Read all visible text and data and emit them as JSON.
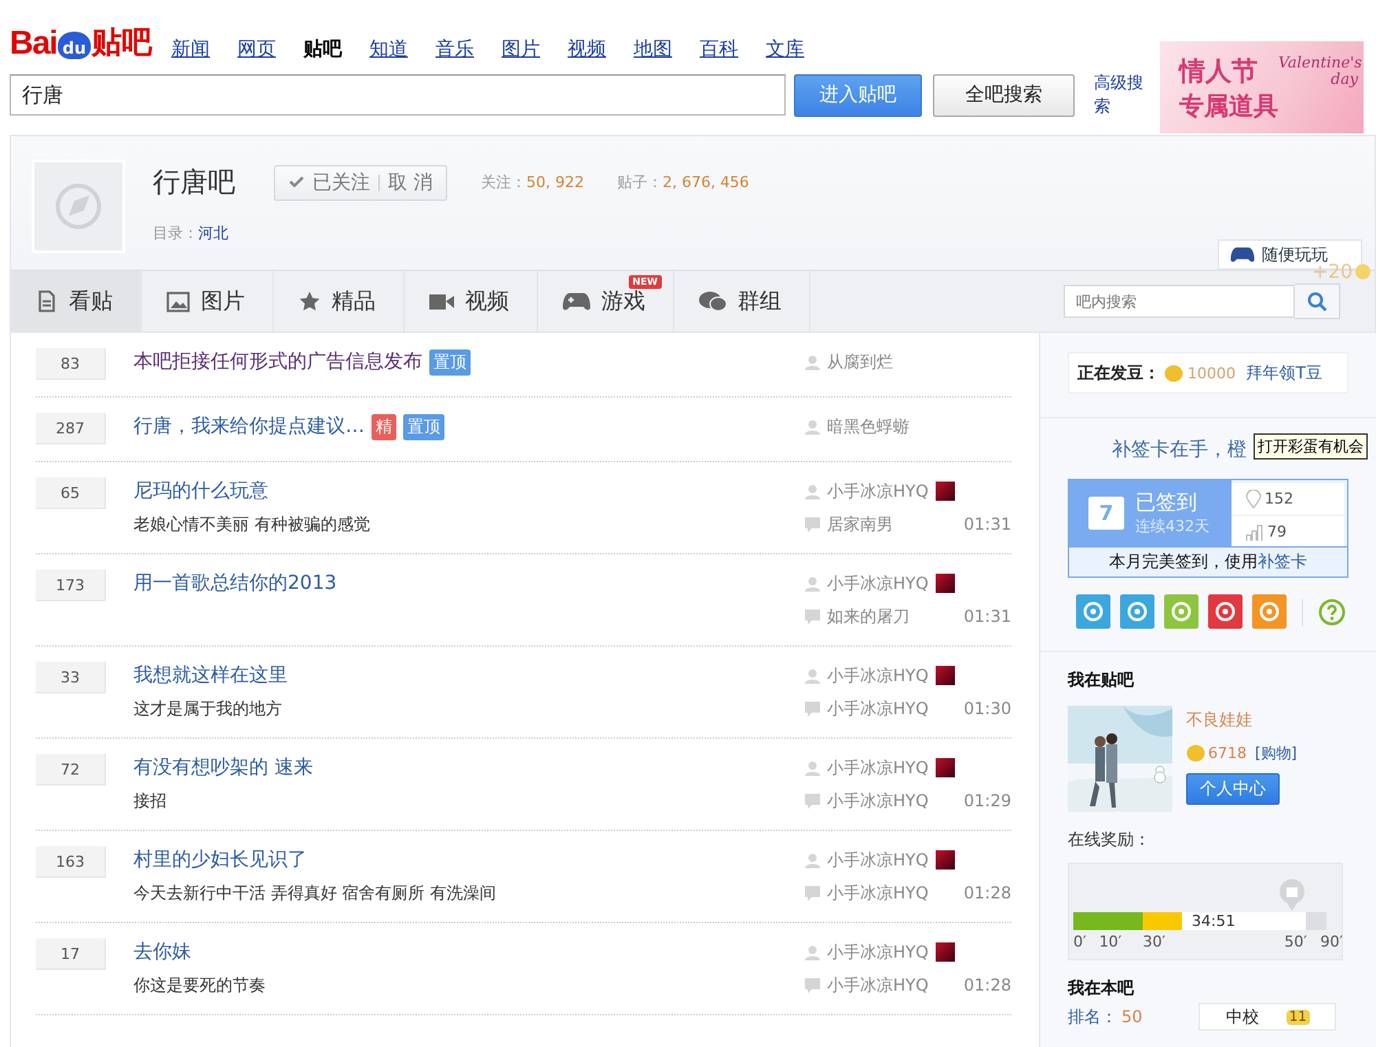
{
  "header": {
    "logo": {
      "brand": "Bai",
      "paw": "du",
      "name": "贴吧"
    },
    "nav": [
      {
        "label": "新闻",
        "selected": false
      },
      {
        "label": "网页",
        "selected": false
      },
      {
        "label": "贴吧",
        "selected": true
      },
      {
        "label": "知道",
        "selected": false
      },
      {
        "label": "音乐",
        "selected": false
      },
      {
        "label": "图片",
        "selected": false
      },
      {
        "label": "视频",
        "selected": false
      },
      {
        "label": "地图",
        "selected": false
      },
      {
        "label": "百科",
        "selected": false
      },
      {
        "label": "文库",
        "selected": false
      }
    ],
    "search": {
      "value": "行唐"
    },
    "buttons": [
      {
        "label": "进入贴吧",
        "kind": "primary"
      },
      {
        "label": "全吧搜索",
        "kind": "secondary"
      }
    ],
    "advanced_link": "高级搜索",
    "banner": {
      "title": "情人节",
      "subtitle": "Valentine's day",
      "tagline": "专属道具"
    }
  },
  "forum": {
    "name": "行唐吧",
    "follow": {
      "label": "已关注",
      "action": "取 消",
      "followed": true
    },
    "stats": [
      {
        "label": "关注：",
        "value": "50, 922"
      },
      {
        "label": "贴子：",
        "value": "2, 676, 456"
      }
    ],
    "directory": {
      "label": "目录：",
      "value": "河北"
    },
    "play_button": "随便玩玩",
    "bonus": "+20"
  },
  "tabs": [
    {
      "label": "看贴",
      "selected": true
    },
    {
      "label": "图片",
      "selected": false
    },
    {
      "label": "精品",
      "selected": false
    },
    {
      "label": "视频",
      "selected": false
    },
    {
      "label": "游戏",
      "selected": false,
      "badge": "NEW"
    },
    {
      "label": "群组",
      "selected": false
    }
  ],
  "tab_search": {
    "placeholder": "吧内搜索"
  },
  "threads": [
    {
      "replies": "83",
      "title": "本吧拒接任何形式的广告信息发布",
      "visited": true,
      "tags": [
        {
          "label": "置顶",
          "color": "#5a9ae6"
        }
      ],
      "author": "从腐到烂",
      "author_badge": false
    },
    {
      "replies": "287",
      "title": "行唐，我来给你提点建议…",
      "visited": false,
      "tags": [
        {
          "label": "精",
          "color": "#e8605a"
        },
        {
          "label": "置顶",
          "color": "#5a9ae6"
        }
      ],
      "author": "暗黑色蜉蝣",
      "author_badge": false
    },
    {
      "replies": "65",
      "title": "尼玛的什么玩意",
      "visited": false,
      "excerpt": "老娘心情不美丽 有种被骗的感觉",
      "author": "小手冰凉HYQ",
      "author_badge": true,
      "last_reply": {
        "author": "居家南男",
        "time": "01:31"
      }
    },
    {
      "replies": "173",
      "title": "用一首歌总结你的2013",
      "visited": false,
      "author": "小手冰凉HYQ",
      "author_badge": true,
      "last_reply": {
        "author": "如来的屠刀",
        "time": "01:31"
      }
    },
    {
      "replies": "33",
      "title": "我想就这样在这里",
      "visited": false,
      "excerpt": "这才是属于我的地方",
      "author": "小手冰凉HYQ",
      "author_badge": true,
      "last_reply": {
        "author": "小手冰凉HYQ",
        "time": "01:30"
      }
    },
    {
      "replies": "72",
      "title": "有没有想吵架的  速来",
      "visited": false,
      "excerpt": "接招",
      "author": "小手冰凉HYQ",
      "author_badge": true,
      "last_reply": {
        "author": "小手冰凉HYQ",
        "time": "01:29"
      }
    },
    {
      "replies": "163",
      "title": "村里的少妇长见识了",
      "visited": false,
      "excerpt": "今天去新行中干活  弄得真好  宿舍有厕所  有洗澡间",
      "author": "小手冰凉HYQ",
      "author_badge": true,
      "last_reply": {
        "author": "小手冰凉HYQ",
        "time": "01:28"
      }
    },
    {
      "replies": "17",
      "title": "去你妹",
      "visited": false,
      "excerpt": "你这是要死的节奏",
      "author": "小手冰凉HYQ",
      "author_badge": true,
      "last_reply": {
        "author": "小手冰凉HYQ",
        "time": "01:28"
      }
    }
  ],
  "sidebar": {
    "beans": {
      "label": "正在发豆：",
      "amount": "10000",
      "link": "拜年领T豆"
    },
    "promo": {
      "text": "补签卡在手，橙",
      "tooltip": "打开彩蛋有机会"
    },
    "signin": {
      "day": "7",
      "status": "已签到",
      "streak": "连续432天",
      "rank": "152",
      "count": "79",
      "note": "本月完美签到，使用",
      "note_link": "补签卡"
    },
    "apps": [
      {
        "color": "#3ba7de"
      },
      {
        "color": "#3ba7de"
      },
      {
        "color": "#8cc63f"
      },
      {
        "color": "#e2383f"
      },
      {
        "color": "#f39423"
      }
    ],
    "me": {
      "heading": "我在贴吧",
      "user": "不良娃娃",
      "beans": "6718",
      "shop": "[购物]",
      "button": "个人中心",
      "reward_label": "在线奖励：",
      "progress": {
        "level": 0.43,
        "time": "34:51",
        "ticks": [
          "0′",
          "10′",
          "30′",
          "50′",
          "90′"
        ]
      }
    },
    "forum_me": {
      "heading": "我在本吧",
      "rank_label": "排名：",
      "rank": "50",
      "title": "中校",
      "level": "11"
    }
  }
}
